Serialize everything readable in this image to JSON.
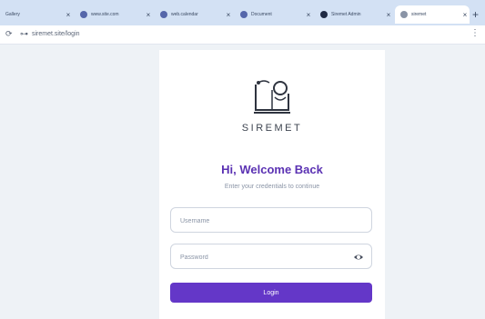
{
  "browser": {
    "tabs": [
      {
        "title": "Gallery"
      },
      {
        "title": "www.site.com"
      },
      {
        "title": "web.calendar"
      },
      {
        "title": "Document"
      },
      {
        "title": "Siremet Admin"
      },
      {
        "title": "siremet",
        "active": true
      }
    ],
    "new_tab_glyph": "+",
    "url": "siremet.site/login"
  },
  "login": {
    "brand": "SIREMET",
    "heading": "Hi, Welcome Back",
    "subtitle": "Enter your credentials to continue",
    "username_placeholder": "Username",
    "password_placeholder": "Password",
    "login_label": "Login"
  },
  "colors": {
    "primary": "#6437c8",
    "heading": "#5b32b3",
    "background": "#eef2f6"
  },
  "icons": [
    "reload-icon",
    "site-info-icon",
    "logo-icon",
    "eye-icon",
    "menu-icon",
    "close-icon"
  ]
}
